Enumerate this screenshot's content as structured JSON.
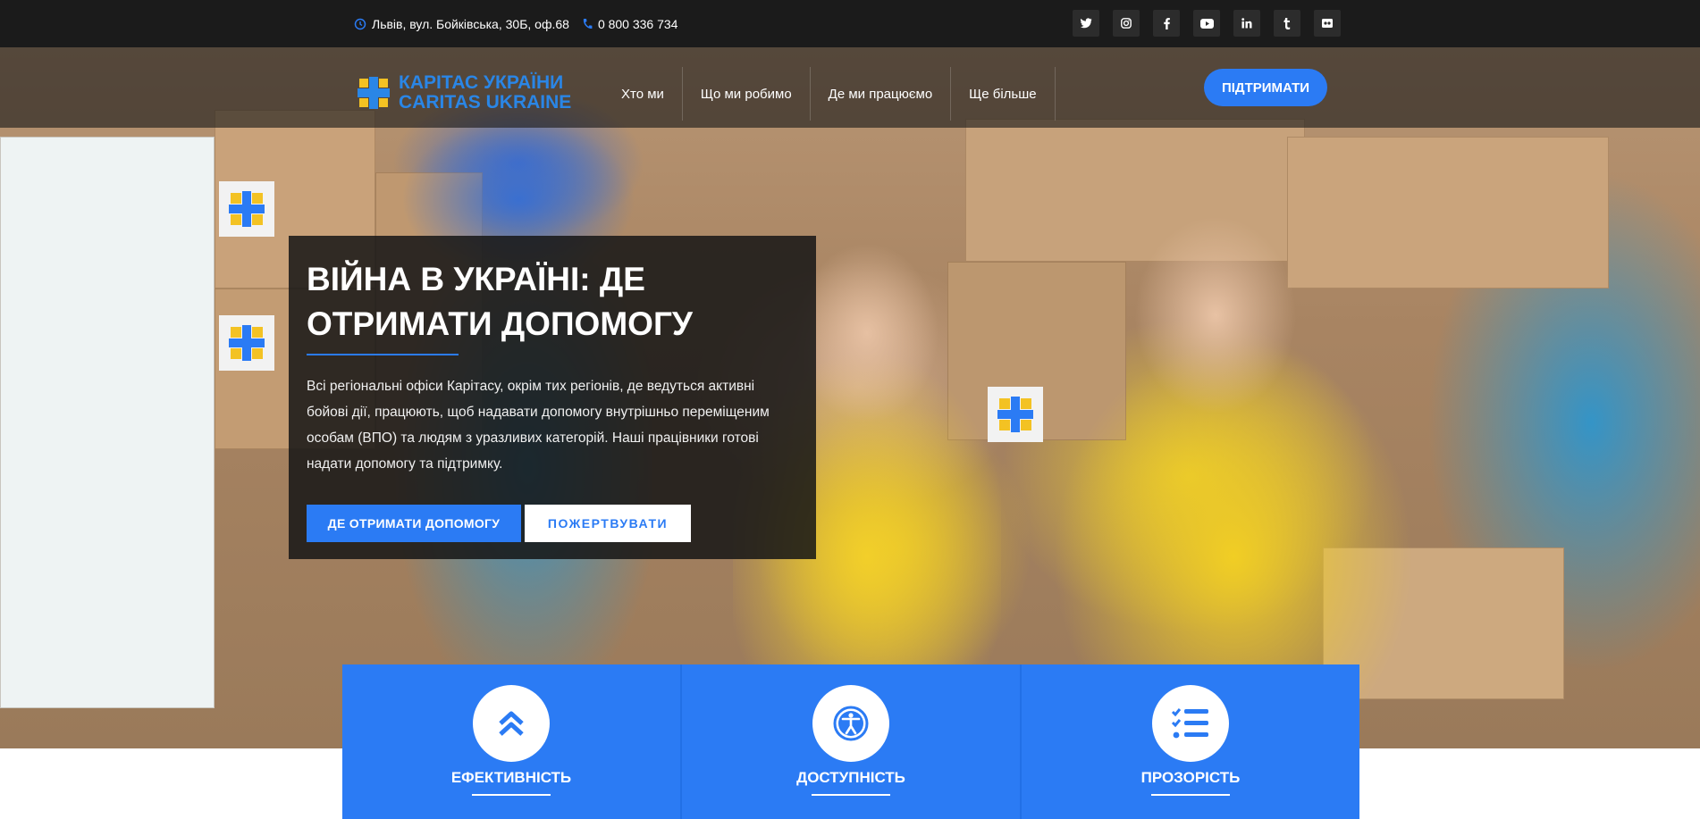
{
  "topbar": {
    "address": "Львів, вул. Бойківська, 30Б, оф.68",
    "phone": "0 800 336 734",
    "socials": [
      "twitter-icon",
      "instagram-icon",
      "facebook-icon",
      "youtube-icon",
      "linkedin-icon",
      "tumblr-icon",
      "flickr-icon"
    ]
  },
  "logo": {
    "line1": "КАРІТАС УКРАЇНИ",
    "line2": "CARITAS UKRAINE"
  },
  "nav": {
    "items": [
      "Хто ми",
      "Що ми робимо",
      "Де ми працюємо",
      "Ще більше"
    ],
    "support_label": "ПІДТРИМАТИ"
  },
  "hero": {
    "title_line1": "ВІЙНА В УКРАЇНІ: ДЕ",
    "title_line2": "ОТРИМАТИ ДОПОМОГУ",
    "text": "Всі регіональні офіси Карітасу, окрім тих регіонів, де ведуться активні бойові дії, працюють, щоб надавати допомогу внутрішньо переміщеним особам (ВПО) та людям з уразливих категорій. Наші працівники готові надати допомогу та підтримку.",
    "primary_button": "ДЕ ОТРИМАТИ ДОПОМОГУ",
    "secondary_button": "ПОЖЕРТВУВАТИ"
  },
  "features": [
    {
      "title": "ЕФЕКТИВНІСТЬ",
      "icon": "double-chevron-up-icon"
    },
    {
      "title": "ДОСТУПНІСТЬ",
      "icon": "accessibility-icon"
    },
    {
      "title": "ПРОЗОРІСТЬ",
      "icon": "checklist-icon"
    }
  ],
  "colors": {
    "accent": "#2b7bf4",
    "topbar": "#1b1b1b",
    "logo": "#2a86e6"
  }
}
